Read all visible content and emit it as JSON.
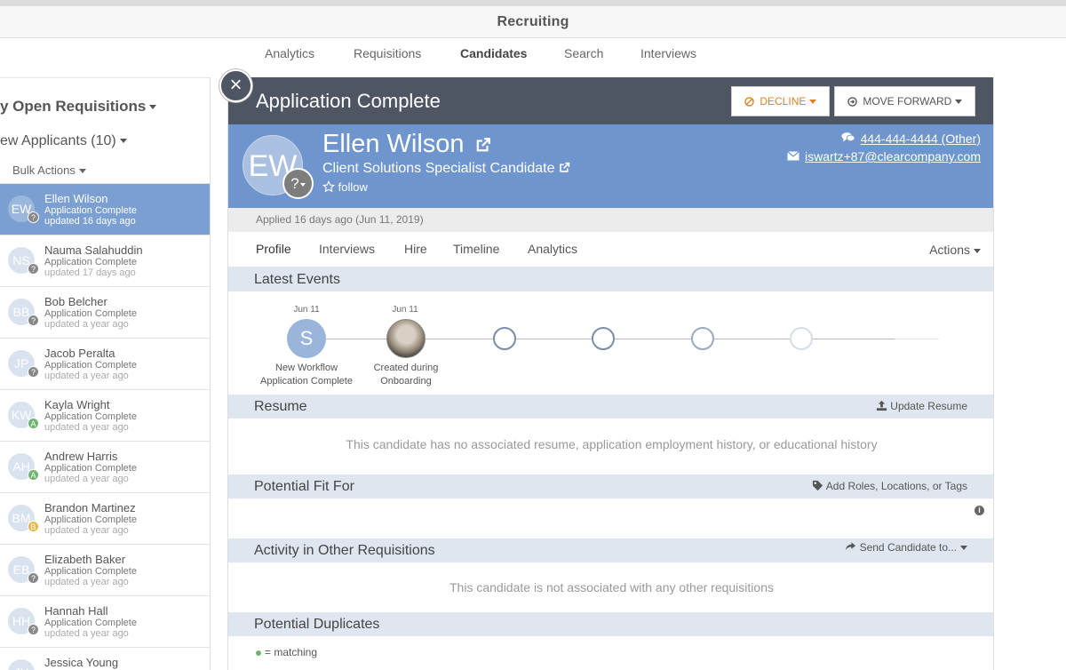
{
  "app": {
    "title": "Recruiting"
  },
  "nav": {
    "items": [
      {
        "label": "Analytics"
      },
      {
        "label": "Requisitions"
      },
      {
        "label": "Candidates",
        "active": true
      },
      {
        "label": "Search"
      },
      {
        "label": "Interviews"
      }
    ]
  },
  "sidebar": {
    "title": "y Open Requisitions",
    "subtitle": "ew Applicants (10)",
    "bulk_actions": "Bulk Actions",
    "candidates": [
      {
        "initials": "EW",
        "name": "Ellen Wilson",
        "status": "Application Complete",
        "updated": "updated 16 days ago",
        "badge": "?",
        "active": true
      },
      {
        "initials": "NS",
        "name": "Nauma Salahuddin",
        "status": "Application Complete",
        "updated": "updated 17 days ago",
        "badge": "?"
      },
      {
        "initials": "BB",
        "name": "Bob Belcher",
        "status": "Application Complete",
        "updated": "updated a year ago",
        "badge": "?"
      },
      {
        "initials": "JP",
        "name": "Jacob Peralta",
        "status": "Application Complete",
        "updated": "updated a year ago",
        "badge": "?"
      },
      {
        "initials": "KW",
        "name": "Kayla Wright",
        "status": "Application Complete",
        "updated": "updated a year ago",
        "badge": "A"
      },
      {
        "initials": "AH",
        "name": "Andrew Harris",
        "status": "Application Complete",
        "updated": "updated a year ago",
        "badge": "A"
      },
      {
        "initials": "BM",
        "name": "Brandon Martinez",
        "status": "Application Complete",
        "updated": "updated a year ago",
        "badge": "B"
      },
      {
        "initials": "EB",
        "name": "Elizabeth Baker",
        "status": "Application Complete",
        "updated": "updated a year ago",
        "badge": "?"
      },
      {
        "initials": "HH",
        "name": "Hannah Hall",
        "status": "Application Complete",
        "updated": "updated a year ago",
        "badge": "?"
      },
      {
        "initials": "JY",
        "name": "Jessica Young",
        "status": "",
        "updated": "",
        "badge": ""
      }
    ]
  },
  "panel": {
    "close_glyph": "×",
    "title": "Application Complete",
    "decline_label": "DECLINE",
    "move_forward_label": "MOVE FORWARD",
    "candidate": {
      "initials": "EW",
      "badge": "?",
      "name": "Ellen Wilson",
      "role": "Client Solutions Specialist Candidate",
      "follow": "follow",
      "phone": "444-444-4444 (Other)",
      "email": "iswartz+87@clearcompany.com"
    },
    "applied": "Applied 16 days ago (Jun 11, 2019)",
    "tabs": [
      {
        "label": "Profile",
        "active": true
      },
      {
        "label": "Interviews"
      },
      {
        "label": "Hire"
      },
      {
        "label": "Timeline"
      },
      {
        "label": "Analytics"
      }
    ],
    "actions_label": "Actions",
    "latest_events": {
      "title": "Latest Events",
      "events": [
        {
          "date": "Jun 11",
          "icon_letter": "S",
          "label_1": "New Workflow",
          "label_2": "Application Complete"
        },
        {
          "date": "Jun 11",
          "icon": "statue-avatar",
          "label_1": "Created during",
          "label_2": "Onboarding"
        }
      ]
    },
    "resume": {
      "title": "Resume",
      "action": "Update Resume",
      "empty": "This candidate has no associated resume, application employment history, or educational history"
    },
    "potential_fit": {
      "title": "Potential Fit For",
      "action": "Add Roles, Locations, or Tags"
    },
    "other_reqs": {
      "title": "Activity in Other Requisitions",
      "action": "Send Candidate to...",
      "empty": "This candidate is not associated with any other requisitions"
    },
    "duplicates": {
      "title": "Potential Duplicates",
      "legend": "= matching"
    }
  },
  "colors": {
    "header_dark": "#4e5563",
    "banner_blue": "#6e95cd",
    "active_row": "#7a9fd0",
    "decline_orange": "#d9822b"
  }
}
